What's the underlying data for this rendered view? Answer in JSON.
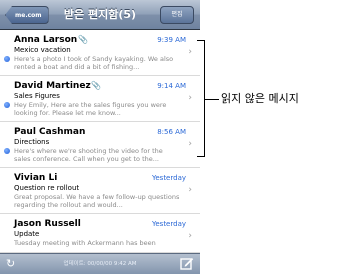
{
  "navbar": {
    "back_label": "me.com",
    "title": "받은 편지함(5)",
    "edit_label": "편집"
  },
  "messages": [
    {
      "sender": "Anna Larson",
      "has_attachment": true,
      "time": "9:39 AM",
      "subject": "Mexico vacation",
      "preview": "Here's a photo I took of Sandy kayaking. We also rented a boat and did a bit of fishing...",
      "unread": true
    },
    {
      "sender": "David Martinez",
      "has_attachment": true,
      "time": "9:14 AM",
      "subject": "Sales Figures",
      "preview": "Hey Emily, Here are the sales figures you were looking for. Please let me know...",
      "unread": true
    },
    {
      "sender": "Paul Cashman",
      "has_attachment": false,
      "time": "8:56 AM",
      "subject": "Directions",
      "preview": "Here's where we're shooting the video for the sales conference. Call when you get to the...",
      "unread": true
    },
    {
      "sender": "Vivian Li",
      "has_attachment": false,
      "time": "Yesterday",
      "subject": "Question re rollout",
      "preview": "Great proposal. We have a few follow-up questions regarding the rollout and would...",
      "unread": false
    },
    {
      "sender": "Jason Russell",
      "has_attachment": false,
      "time": "Yesterday",
      "subject": "Update",
      "preview": "Tuesday meeting with Ackermann has been",
      "unread": false
    }
  ],
  "toolbar": {
    "status_text": "업데이트: 00/00/00 9:42 AM"
  },
  "callout": {
    "label": "읽지 않은 메시지"
  },
  "icons": {
    "attachment": "paperclip-icon",
    "refresh": "refresh-icon",
    "compose": "compose-icon",
    "chevron": "chevron-right-icon"
  },
  "colors": {
    "time_blue": "#2a68d6",
    "unread_dot": "#2361d8",
    "navbar": "#8fa0b8"
  }
}
